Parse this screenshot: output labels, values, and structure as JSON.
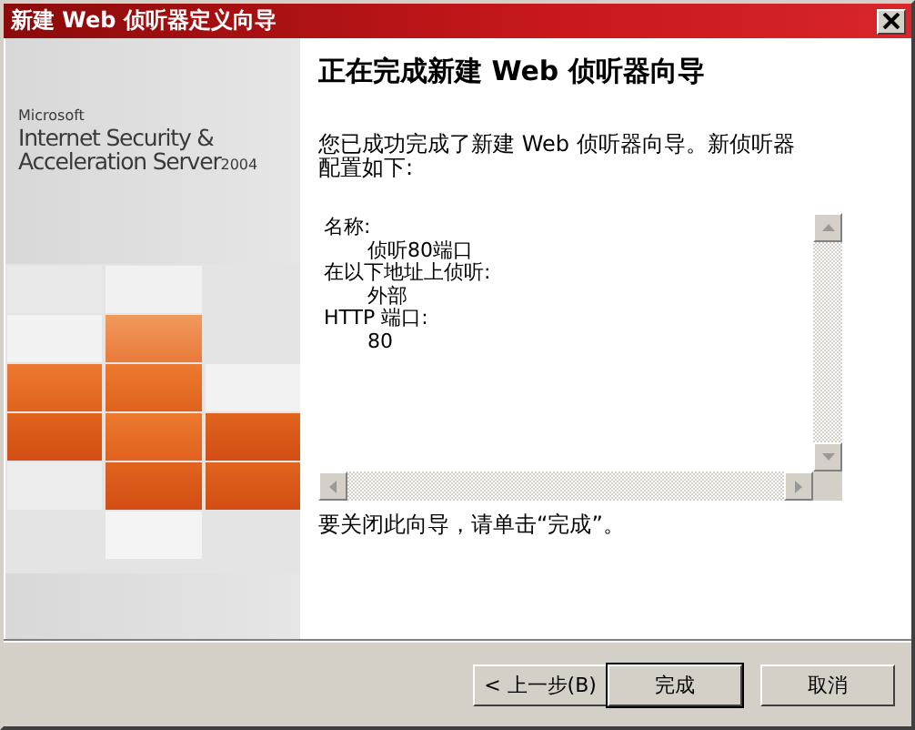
{
  "window": {
    "title": "新建 Web 侦听器定义向导"
  },
  "branding": {
    "company": "Microsoft",
    "line_1": "Internet Security &",
    "line_2": "Acceleration Server",
    "version": "2004"
  },
  "heading": "正在完成新建 Web 侦听器向导",
  "intro": "您已成功完成了新建 Web 侦听器向导。新侦听器配置如下:",
  "summary": [
    {
      "text": "名称:",
      "children": [
        {
          "text": "侦听80端口"
        }
      ]
    },
    {
      "text": "在以下地址上侦听:",
      "children": [
        {
          "text": "外部"
        }
      ]
    },
    {
      "text": "HTTP 端口:",
      "children": [
        {
          "text": "80"
        }
      ]
    }
  ],
  "closing": "要关闭此向导，请单击“完成”。",
  "buttons": [
    {
      "label": "< 上一步(B)",
      "default": false
    },
    {
      "label": "完成",
      "default": true
    },
    {
      "label": "取消",
      "default": false
    }
  ]
}
